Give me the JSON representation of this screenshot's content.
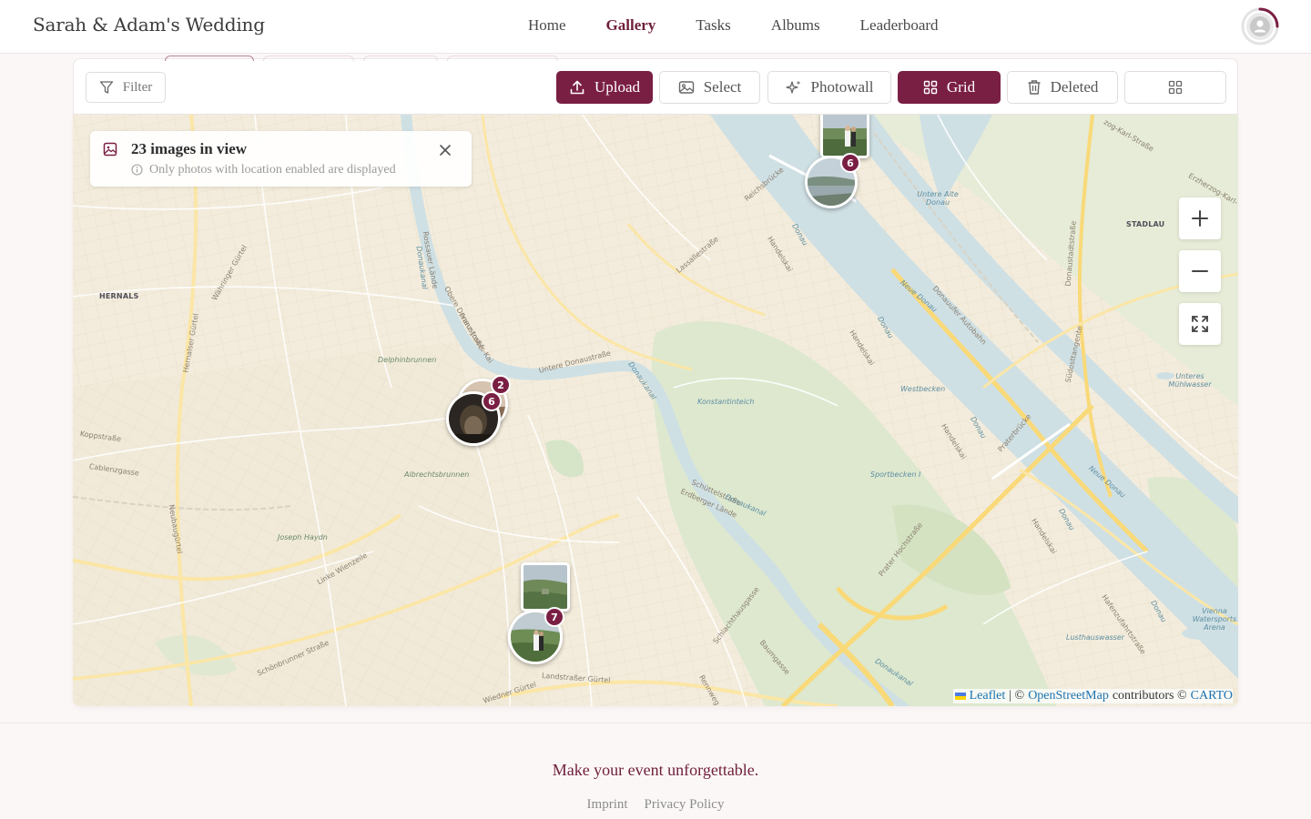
{
  "app": {
    "title": "Sarah & Adam's Wedding"
  },
  "nav": {
    "items": [
      {
        "label": "Home"
      },
      {
        "label": "Gallery"
      },
      {
        "label": "Tasks"
      },
      {
        "label": "Albums"
      },
      {
        "label": "Leaderboard"
      }
    ],
    "active": "Gallery"
  },
  "toolbar": {
    "filter_label": "Filter",
    "upload_label": "Upload",
    "select_label": "Select",
    "photowall_label": "Photowall",
    "grid_label": "Grid",
    "deleted_label": "Deleted"
  },
  "map": {
    "info_title": "23 images in view",
    "info_subtitle": "Only photos with location enabled are displayed",
    "clusters": [
      {
        "count": "6"
      },
      {
        "count": "2"
      },
      {
        "count": "6"
      },
      {
        "count": "7"
      }
    ],
    "labels": {
      "hernals": "HERNALS",
      "stadlau": "STADLAU",
      "delphinbrunnen": "Delphinbrunnen",
      "albrechtsbrunnen": "Albrechtsbrunnen",
      "joseph_haydn": "Joseph Haydn",
      "konstantinteich": "Konstantinteich",
      "westbecken": "Westbecken",
      "sportbecken": "Sportbecken I",
      "untere_alte_donau": "Untere Alte Donau",
      "unteres_muehlwasser": "Unteres Mühlwasser",
      "lusthauswasser": "Lusthauswasser",
      "vienna_watersports": "Vienna Watersports Arena",
      "obere_donaustrasse": "Obere Donaustraße",
      "untere_donaustrasse": "Untere Donaustraße",
      "handelskai": "Handelskai",
      "lassallestrasse": "Lassallestraße",
      "reichsbruecke": "Reichsbrücke",
      "praterbruecke": "Praterbrücke",
      "prater_hochstrasse": "Prater Hochstraße",
      "donauufer_autobahn": "Donauufer Autobahn",
      "suedosttangente": "Südosttangente",
      "linke_wienzeile": "Linke Wienzeile",
      "landstrasser_guertel": "Landstraßer Gürtel",
      "wiedner_guertel": "Wiedner Gürtel",
      "schoenbrunner_strasse": "Schönbrunner Straße",
      "koppstrasse": "Koppstraße",
      "cablenzgasse": "Cablenzgasse",
      "neubauguertel": "Neubaugürtel",
      "hernalser_guertel": "Hernalser Gürtel",
      "waehringer_guertel": "Währinger Gürtel",
      "rossauer_laende": "Rossauer Lände",
      "franz_josefs_kai": "Franz-Josefs-Kai",
      "schuettelstrasse": "Schüttelstraße",
      "erdberger_laende": "Erdberger Lände",
      "schlachthausgasse": "Schlachthausgasse",
      "baumgasse": "Baumgasse",
      "donaustadtstrasse": "Donaustadtstraße",
      "erzherzog_karl": "Erzherzog-Karl-",
      "zog_karl_strasse": "zog-Karl-Straße",
      "donau": "Donau",
      "neue_donau": "Neue Donau",
      "donaukanal": "Donaukanal",
      "hafenzufahrtstrasse": "Hafenzufahrtstraße",
      "rennweg": "Rennweg"
    },
    "attribution": {
      "leaflet": "Leaflet",
      "separator": "| ©",
      "osm": "OpenStreetMap",
      "contributors": "contributors ©",
      "carto": "CARTO"
    }
  },
  "footer": {
    "tagline": "Make your event unforgettable.",
    "links": [
      {
        "label": "Imprint"
      },
      {
        "label": "Privacy Policy"
      }
    ]
  },
  "colors": {
    "brand": "#7a1f44",
    "map_land": "#f3ecdc",
    "map_water": "#cfe0e4",
    "map_park": "#dde8cf",
    "map_road": "#fbe6a6"
  }
}
